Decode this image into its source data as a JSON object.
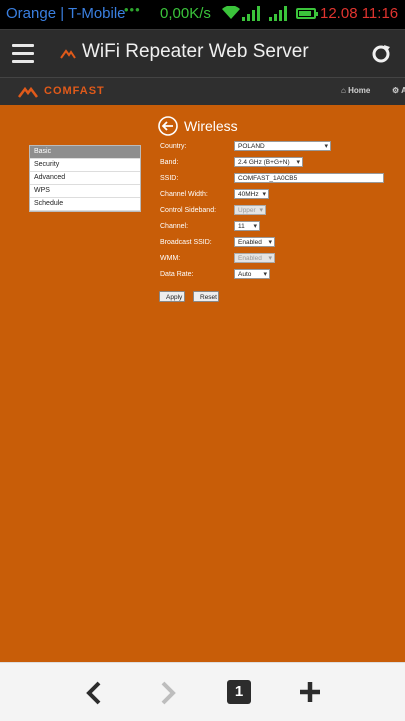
{
  "status_bar": {
    "carrier": "Orange | T-Mobile",
    "data_speed": "0,00K/s",
    "date_time": "12.08 11:16",
    "battery_level": 0.85,
    "colors": {
      "carrier": "#3a7fe0",
      "speed": "#3bc43b",
      "time": "#e0342f"
    }
  },
  "app_bar": {
    "title": "WiFi Repeater Web Server",
    "menu_icon": "hamburger-menu-icon",
    "refresh_icon": "refresh-icon"
  },
  "router_nav": {
    "brand": "COMFAST",
    "home_label": "Home",
    "advanced_label": "A",
    "brand_color": "#e05a1a"
  },
  "side_menu": {
    "items": [
      {
        "label": "Basic",
        "active": true
      },
      {
        "label": "Security",
        "active": false
      },
      {
        "label": "Advanced",
        "active": false
      },
      {
        "label": "WPS",
        "active": false
      },
      {
        "label": "Schedule",
        "active": false
      }
    ]
  },
  "wireless": {
    "title": "Wireless",
    "fields": {
      "country": {
        "label": "Country:",
        "value": "POLAND"
      },
      "band": {
        "label": "Band:",
        "value": "2.4 GHz (B+G+N)"
      },
      "ssid": {
        "label": "SSID:",
        "value": "COMFAST_1A0CB5"
      },
      "channel_width": {
        "label": "Channel Width:",
        "value": "40MHz"
      },
      "control_sideband": {
        "label": "Control Sideband:",
        "value": "Upper"
      },
      "channel": {
        "label": "Channel:",
        "value": "11"
      },
      "broadcast_ssid": {
        "label": "Broadcast SSID:",
        "value": "Enabled"
      },
      "wmm": {
        "label": "WMM:",
        "value": "Enabled"
      },
      "data_rate": {
        "label": "Data Rate:",
        "value": "Auto"
      }
    },
    "apply_label": "Apply",
    "reset_label": "Reset",
    "background_color": "#c85d08"
  },
  "bottom_bar": {
    "tab_count": "1"
  }
}
